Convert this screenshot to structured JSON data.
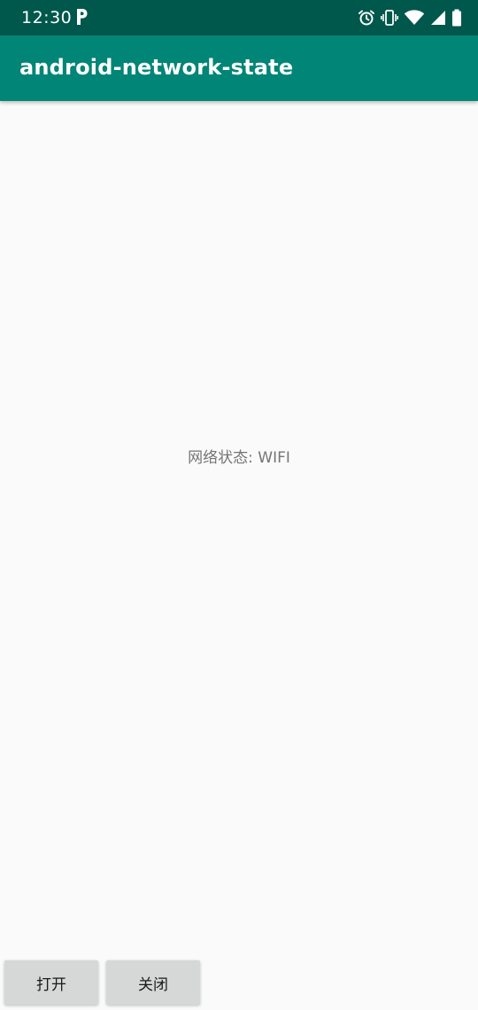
{
  "status_bar": {
    "time": "12:30",
    "icons": [
      "parking-icon",
      "alarm-icon",
      "vibrate-icon",
      "wifi-icon",
      "cell-signal-icon",
      "battery-icon"
    ]
  },
  "app_bar": {
    "title": "android-network-state"
  },
  "main": {
    "network_status": "网络状态: WIFI"
  },
  "buttons": {
    "open_label": "打开",
    "close_label": "关闭"
  },
  "colors": {
    "status_bar": "#00574b",
    "app_bar": "#008577",
    "background": "#fafafa",
    "button": "#d6d7d7"
  }
}
